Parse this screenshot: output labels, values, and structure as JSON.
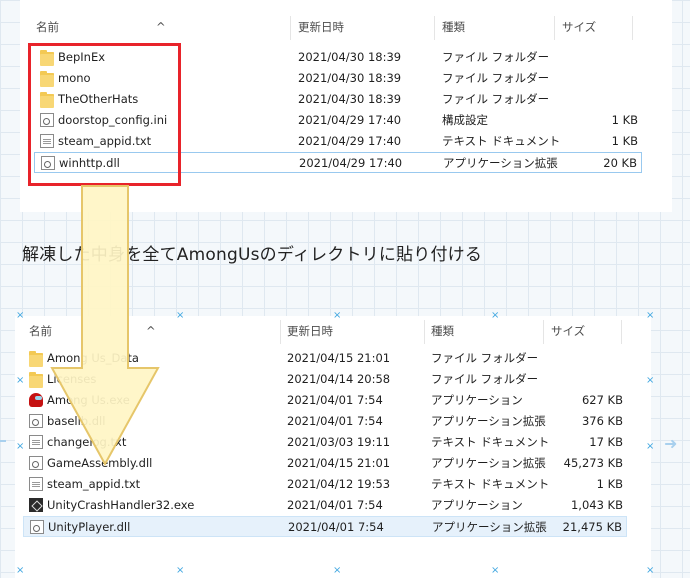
{
  "columns": {
    "name": "名前",
    "date": "更新日時",
    "type": "種類",
    "size": "サイズ"
  },
  "panel1": {
    "files": [
      {
        "name": "BepInEx",
        "date": "2021/04/30 18:39",
        "type": "ファイル フォルダー",
        "size": "",
        "icon": "folder-icon"
      },
      {
        "name": "mono",
        "date": "2021/04/30 18:39",
        "type": "ファイル フォルダー",
        "size": "",
        "icon": "folder-icon"
      },
      {
        "name": "TheOtherHats",
        "date": "2021/04/30 18:39",
        "type": "ファイル フォルダー",
        "size": "",
        "icon": "folder-icon"
      },
      {
        "name": "doorstop_config.ini",
        "date": "2021/04/29 17:40",
        "type": "構成設定",
        "size": "1 KB",
        "icon": "settings-file-icon"
      },
      {
        "name": "steam_appid.txt",
        "date": "2021/04/29 17:40",
        "type": "テキスト ドキュメント",
        "size": "1 KB",
        "icon": "text-file-icon"
      },
      {
        "name": "winhttp.dll",
        "date": "2021/04/29 17:40",
        "type": "アプリケーション拡張",
        "size": "20 KB",
        "icon": "dll-file-icon"
      }
    ]
  },
  "caption": "解凍した中身を全てAmongUsのディレクトリに貼り付ける",
  "panel2": {
    "files": [
      {
        "name": "Among Us_Data",
        "date": "2021/04/15 21:01",
        "type": "ファイル フォルダー",
        "size": "",
        "icon": "folder-icon"
      },
      {
        "name": "Licenses",
        "date": "2021/04/14 20:58",
        "type": "ファイル フォルダー",
        "size": "",
        "icon": "folder-icon"
      },
      {
        "name": "Among Us.exe",
        "date": "2021/04/01 7:54",
        "type": "アプリケーション",
        "size": "627 KB",
        "icon": "among-us-app-icon"
      },
      {
        "name": "baselib.dll",
        "date": "2021/04/01 7:54",
        "type": "アプリケーション拡張",
        "size": "376 KB",
        "icon": "dll-file-icon"
      },
      {
        "name": "changelog.txt",
        "date": "2021/03/03 19:11",
        "type": "テキスト ドキュメント",
        "size": "17 KB",
        "icon": "text-file-icon"
      },
      {
        "name": "GameAssembly.dll",
        "date": "2021/04/15 21:01",
        "type": "アプリケーション拡張",
        "size": "45,273 KB",
        "icon": "dll-file-icon"
      },
      {
        "name": "steam_appid.txt",
        "date": "2021/04/12 19:53",
        "type": "テキスト ドキュメント",
        "size": "1 KB",
        "icon": "text-file-icon"
      },
      {
        "name": "UnityCrashHandler32.exe",
        "date": "2021/04/01 7:54",
        "type": "アプリケーション",
        "size": "1,043 KB",
        "icon": "unity-app-icon"
      },
      {
        "name": "UnityPlayer.dll",
        "date": "2021/04/01 7:54",
        "type": "アプリケーション拡張",
        "size": "21,475 KB",
        "icon": "dll-file-icon"
      }
    ]
  },
  "colors": {
    "highlight_box": "#e8232a",
    "arrow_fill": "#fff5c4",
    "arrow_stroke": "#e6c66a",
    "selection": "#e6f1fb"
  }
}
